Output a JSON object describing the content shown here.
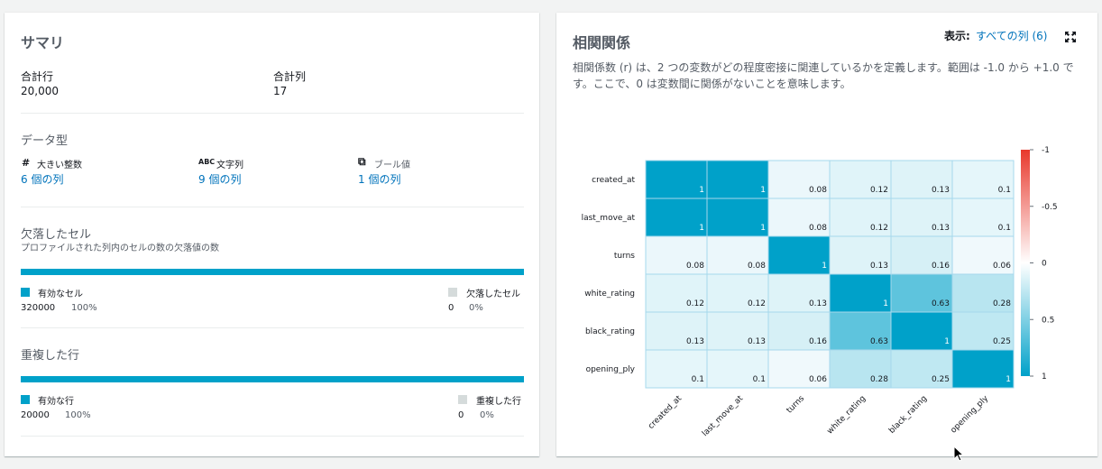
{
  "summary": {
    "title": "サマリ",
    "total_rows_label": "合計行",
    "total_rows_value": "20,000",
    "total_cols_label": "合計列",
    "total_cols_value": "17",
    "dtype_heading": "データ型",
    "dtypes": [
      {
        "icon": "#",
        "label": "大きい整数",
        "link": "6 個の列"
      },
      {
        "icon": "ABC",
        "label": "文字列",
        "link": "9 個の列"
      },
      {
        "icon": "⧉",
        "label": "ブール値",
        "link": "1 個の列"
      }
    ],
    "missing_heading": "欠落したセル",
    "missing_sub": "プロファイルされた列内のセルの数の欠落値の数",
    "missing_valid_label": "有効なセル",
    "missing_valid_count": "320000",
    "missing_valid_pct": "100%",
    "missing_missing_label": "欠落したセル",
    "missing_missing_count": "0",
    "missing_missing_pct": "0%",
    "dup_heading": "重複した行",
    "dup_valid_label": "有効な行",
    "dup_valid_count": "20000",
    "dup_valid_pct": "100%",
    "dup_dup_label": "重複した行",
    "dup_dup_count": "0",
    "dup_dup_pct": "0%"
  },
  "correlation": {
    "title": "相関関係",
    "display_label": "表示:",
    "display_value": "すべての列 (6)",
    "description": "相関係数 (r) は、2 つの変数がどの程度密接に関連しているかを定義します。範囲は -1.0 から +1.0 です。ここで、0 は変数間に関係がないことを意味します。"
  },
  "chart_data": {
    "type": "heatmap",
    "rows": [
      "created_at",
      "last_move_at",
      "turns",
      "white_rating",
      "black_rating",
      "opening_ply"
    ],
    "columns": [
      "created_at",
      "last_move_at",
      "turns",
      "white_rating",
      "black_rating",
      "opening_ply"
    ],
    "values": [
      [
        1,
        1,
        0.08,
        0.12,
        0.13,
        0.1
      ],
      [
        1,
        1,
        0.08,
        0.12,
        0.13,
        0.1
      ],
      [
        0.08,
        0.08,
        1,
        0.13,
        0.16,
        0.06
      ],
      [
        0.12,
        0.12,
        0.13,
        1,
        0.63,
        0.28
      ],
      [
        0.13,
        0.13,
        0.16,
        0.63,
        1,
        0.25
      ],
      [
        0.1,
        0.1,
        0.06,
        0.28,
        0.25,
        1
      ]
    ],
    "colorbar_ticks": [
      "-1",
      "-0.5",
      "0",
      "0.5",
      "1"
    ],
    "colorbar_range": [
      -1,
      1
    ],
    "colors": {
      "negative": "#e8382c",
      "zero": "#ffffff",
      "positive": "#00a1c9"
    }
  }
}
